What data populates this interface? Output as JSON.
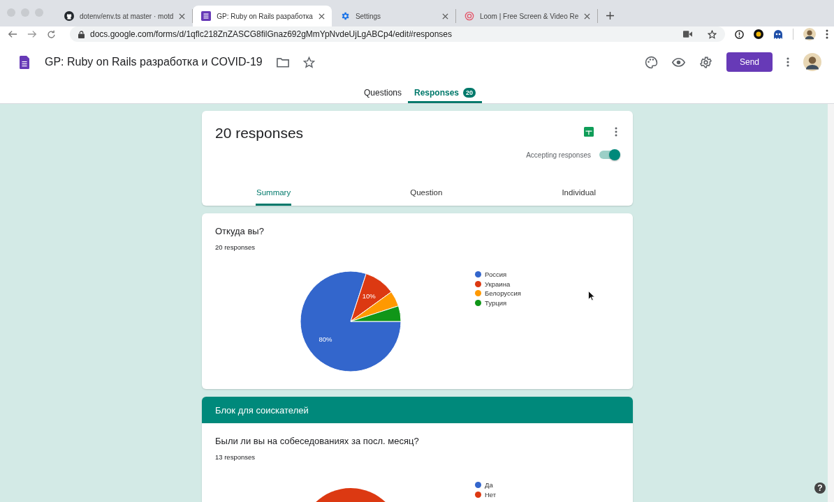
{
  "browser": {
    "tabs": [
      {
        "kind": "github",
        "title": "dotenv/env.ts at master · motd",
        "selected": false
      },
      {
        "kind": "forms",
        "title": "GP: Ruby on Rails разработка",
        "selected": true
      },
      {
        "kind": "settings",
        "title": "Settings",
        "selected": false
      },
      {
        "kind": "loom",
        "title": "Loom | Free Screen & Video Re",
        "selected": false
      }
    ],
    "url": "docs.google.com/forms/d/1qflc218ZnZASCG8filGnaz692gMmYpNvdeUjLgABCp4/edit#responses"
  },
  "form": {
    "title": "GP: Ruby on Rails разработка и COVID-19",
    "send_button": "Send",
    "tabs": [
      {
        "label": "Questions",
        "selected": false
      },
      {
        "label": "Responses",
        "selected": true,
        "badge": "20"
      }
    ]
  },
  "summary": {
    "title": "20 responses",
    "accepting_label": "Accepting responses",
    "accepting": true,
    "tabs": [
      {
        "label": "Summary",
        "selected": true
      },
      {
        "label": "Question",
        "selected": false
      },
      {
        "label": "Individual",
        "selected": false
      }
    ]
  },
  "questions": [
    {
      "title": "Откуда вы?",
      "count": "20 responses",
      "chart_data": {
        "type": "pie",
        "categories": [
          "Россия",
          "Украина",
          "Белоруссия",
          "Турция"
        ],
        "values": [
          80,
          10,
          5,
          5
        ],
        "legend": true,
        "colors": [
          "#3366cc",
          "#dc3912",
          "#ff9900",
          "#109618"
        ],
        "value_labels": [
          "80%",
          "10%",
          null,
          null
        ]
      }
    }
  ],
  "section": {
    "title": "Блок для соискателей"
  },
  "question2": {
    "title": "Были ли вы на собеседованиях за посл. месяц?",
    "count": "13 responses",
    "legend": [
      {
        "label": "Да",
        "color": "#3366cc"
      },
      {
        "label": "Нет",
        "color": "#dc3912"
      }
    ]
  },
  "help": "?"
}
